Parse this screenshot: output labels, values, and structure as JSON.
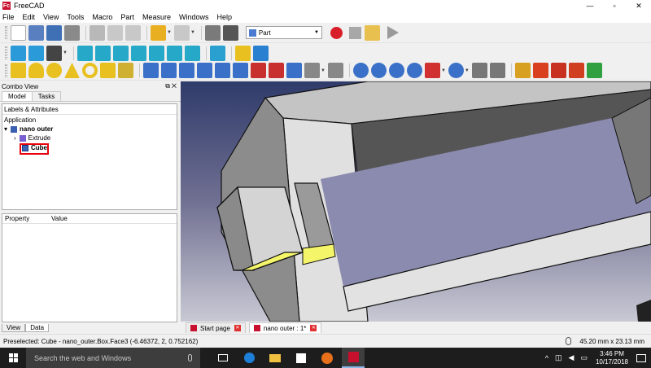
{
  "window": {
    "title": "FreeCAD",
    "controls": [
      "—",
      "▫",
      "✕"
    ]
  },
  "menu": [
    "File",
    "Edit",
    "View",
    "Tools",
    "Macro",
    "Part",
    "Measure",
    "Windows",
    "Help"
  ],
  "workbench": {
    "selected": "Part"
  },
  "combo_view": {
    "title": "Combo View",
    "tabs": [
      "Model",
      "Tasks"
    ],
    "tree_header": "Labels & Attributes",
    "tree_root": "Application",
    "document": "nano outer",
    "items": [
      "Extrude",
      "Cube"
    ],
    "property_columns": [
      "Property",
      "Value"
    ],
    "bottom_tabs": [
      "View",
      "Data"
    ]
  },
  "doc_tabs": [
    "Start page",
    "nano outer : 1*"
  ],
  "status": {
    "message": "Preselected: Cube - nano_outer.Box.Face3 (-6.46372, 2, 0.752162)",
    "dimensions": "45.20 mm x 23.13 mm"
  },
  "taskbar": {
    "search_placeholder": "Search the web and Windows",
    "time": "3:46 PM",
    "date": "10/17/2018"
  },
  "colors": {
    "highlight": "#e8000d",
    "selected_face": "#f5f56a",
    "viewport_top": "#2f3b6a"
  }
}
